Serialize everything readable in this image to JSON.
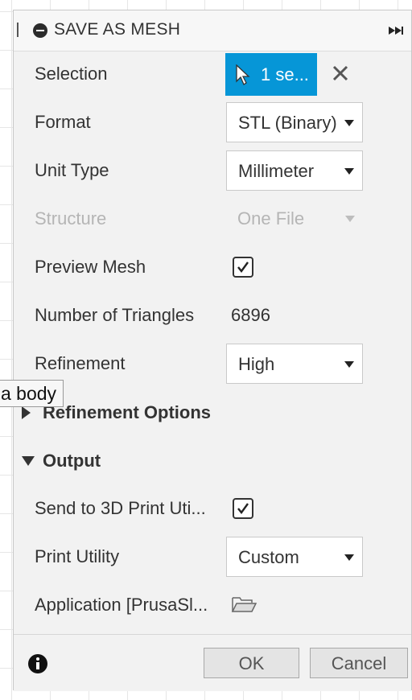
{
  "dialog": {
    "title": "SAVE AS MESH"
  },
  "selection": {
    "label": "Selection",
    "button_text": "1 se..."
  },
  "format": {
    "label": "Format",
    "value": "STL (Binary)"
  },
  "unit_type": {
    "label": "Unit Type",
    "value": "Millimeter"
  },
  "structure": {
    "label": "Structure",
    "value": "One File"
  },
  "preview_mesh": {
    "label": "Preview Mesh",
    "checked": true
  },
  "triangles": {
    "label": "Number of Triangles",
    "value": "6896"
  },
  "refinement": {
    "label": "Refinement",
    "value": "High"
  },
  "refinement_options": {
    "label": "Refinement Options",
    "expanded": false
  },
  "output": {
    "label": "Output",
    "expanded": true,
    "send_to_print": {
      "label": "Send to 3D Print Uti...",
      "checked": true
    },
    "print_utility": {
      "label": "Print Utility",
      "value": "Custom"
    },
    "application": {
      "label": "Application [PrusaSl..."
    }
  },
  "footer": {
    "ok_label": "OK",
    "cancel_label": "Cancel"
  },
  "tooltip": {
    "text": "a body"
  },
  "colors": {
    "accent": "#0696d7"
  }
}
